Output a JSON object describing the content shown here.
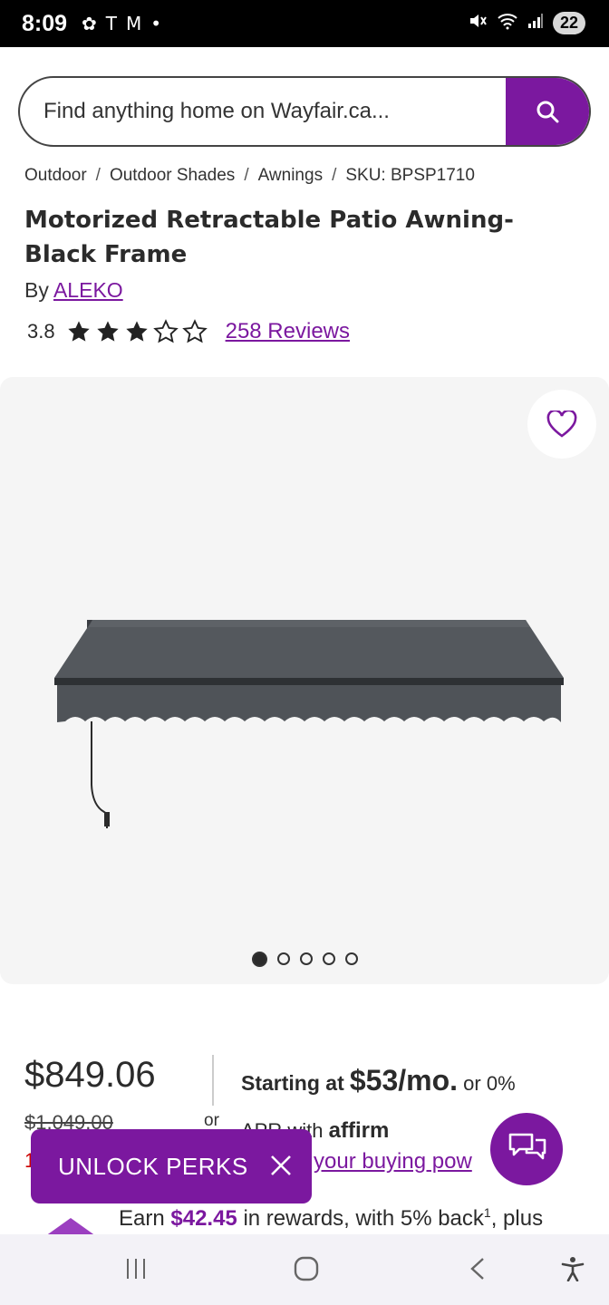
{
  "status_bar": {
    "time": "8:09",
    "battery": "22"
  },
  "search": {
    "placeholder": "Find anything home on Wayfair.ca..."
  },
  "breadcrumb": {
    "items": [
      "Outdoor",
      "Outdoor Shades",
      "Awnings",
      "SKU: BPSP1710"
    ],
    "separator": "/"
  },
  "product": {
    "title": "Motorized Retractable Patio Awning- Black Frame",
    "by_label": "By",
    "brand": "ALEKO",
    "rating": "3.8",
    "rating_stars": 3.8,
    "reviews": "258 Reviews"
  },
  "gallery": {
    "image_count": 5,
    "active_index": 0
  },
  "pricing": {
    "price": "$849.06",
    "original_price": "$1,049.00",
    "or": "or",
    "starting_at": "Starting at",
    "monthly": "$53/mo.",
    "apr_text_1": "or 0%",
    "apr_text_2": "APR with",
    "affirm": "affirm",
    "buying_power": "your buying pow",
    "red_fragment": "1"
  },
  "rewards": {
    "earn": "Earn",
    "amount": "$42.45",
    "rest": "in rewards, with 5% back",
    "superscript": "1",
    "suffix": ", plus"
  },
  "promo": {
    "label": "UNLOCK PERKS"
  },
  "colors": {
    "brand": "#7b189f",
    "text": "#2b2b2b",
    "gallery_bg": "#f5f5f5"
  }
}
